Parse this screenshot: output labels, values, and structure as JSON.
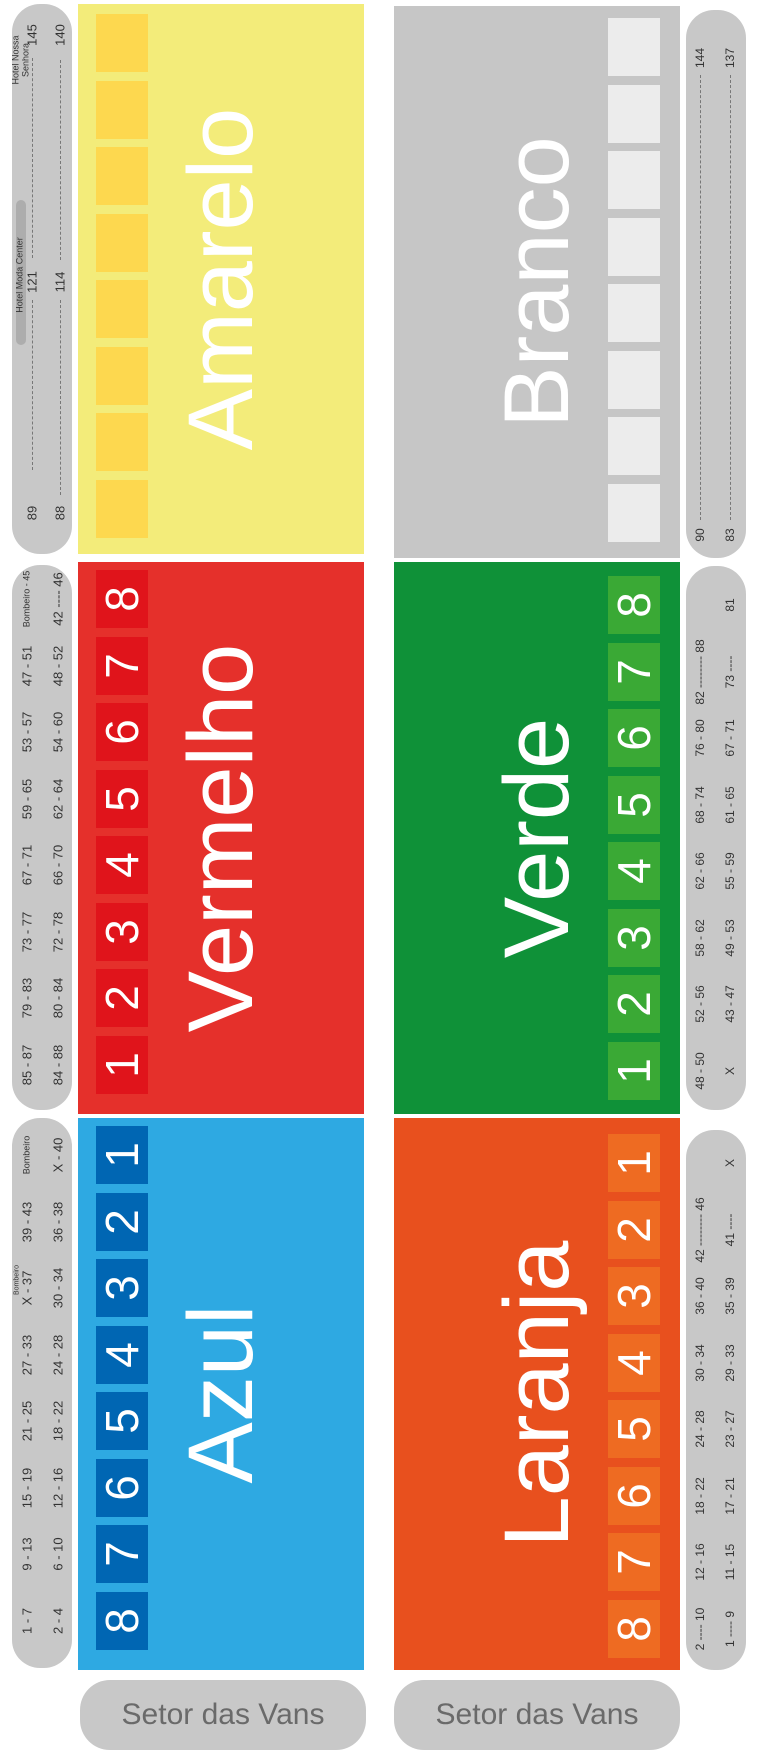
{
  "colors": {
    "azul": "#2ea9e2",
    "azul_box": "#0066b3",
    "vermelho": "#e5302b",
    "vermelho_box": "#e0141b",
    "amarelo": "#f3ec7a",
    "amarelo_box": "#fdd84f",
    "laranja": "#e8501e",
    "laranja_box": "#ee6b22",
    "verde": "#0f9138",
    "verde_box": "#3aa935",
    "branco": "#c6c6c6",
    "branco_box": "#ececec",
    "strip": "#c8c8c8"
  },
  "sectors": {
    "azul": {
      "name": "Azul",
      "boxes": [
        "1",
        "2",
        "3",
        "4",
        "5",
        "6",
        "7",
        "8"
      ]
    },
    "vermelho": {
      "name": "Vermelho",
      "boxes": [
        "8",
        "7",
        "6",
        "5",
        "4",
        "3",
        "2",
        "1"
      ]
    },
    "amarelo": {
      "name": "Amarelo"
    },
    "laranja": {
      "name": "Laranja",
      "boxes": [
        "1",
        "2",
        "3",
        "4",
        "5",
        "6",
        "7",
        "8"
      ]
    },
    "verde": {
      "name": "Verde",
      "boxes": [
        "8",
        "7",
        "6",
        "5",
        "4",
        "3",
        "2",
        "1"
      ]
    },
    "branco": {
      "name": "Branco"
    }
  },
  "left_labels": {
    "azul": {
      "row1": [
        "1 - 7",
        "9 - 13",
        "15 - 19",
        "21 - 25",
        "27 - 33",
        "X - 37",
        "39 - 43",
        "Bombeiro"
      ],
      "row2": [
        "2 - 4",
        "6 - 10",
        "12 - 16",
        "18 - 22",
        "24 - 28",
        "30 - 34",
        "36 - 38",
        "X - 40"
      ],
      "note": "Bombeiro"
    },
    "vermelho": {
      "row1": [
        "Bombeiro - 45",
        "47 - 51",
        "53 - 57",
        "59 - 65",
        "67 - 71",
        "73 - 77",
        "79 - 83",
        "85 - 87"
      ],
      "row2": [
        "42 ---- 46",
        "48 - 52",
        "54 - 60",
        "62 - 64",
        "66 - 70",
        "72 - 78",
        "80 - 84",
        "84 - 88"
      ]
    },
    "amarelo": {
      "row1": [
        "89",
        "121",
        "145"
      ],
      "row2": [
        "88",
        "114",
        "140"
      ],
      "hotel1": "Hotel Moda Center",
      "hotel2a": "Hotel Nossa",
      "hotel2b": "Senhora"
    }
  },
  "right_labels": {
    "laranja": {
      "row1": [
        "2 ---- 10",
        "12 - 16",
        "18 - 22",
        "24 - 28",
        "30 - 34",
        "36 - 40",
        "42 -------- 46"
      ],
      "row2": [
        "1 ---- 9",
        "11 - 15",
        "17 - 21",
        "23 - 27",
        "29 - 33",
        "35 - 39",
        "41 ----",
        "X"
      ]
    },
    "verde": {
      "row1": [
        "48 - 50",
        "52 - 56",
        "58 - 62",
        "62 - 66",
        "68 - 74",
        "76 - 80",
        "82 -------- 88"
      ],
      "row2": [
        "X",
        "43 - 47",
        "49 - 53",
        "55 - 59",
        "61 - 65",
        "67 - 71",
        "73 ----",
        "81"
      ]
    },
    "branco": {
      "row1": [
        "90",
        "144"
      ],
      "row2": [
        "83",
        "137"
      ]
    }
  },
  "footer": {
    "left": "Setor das Vans",
    "right": "Setor das Vans"
  }
}
